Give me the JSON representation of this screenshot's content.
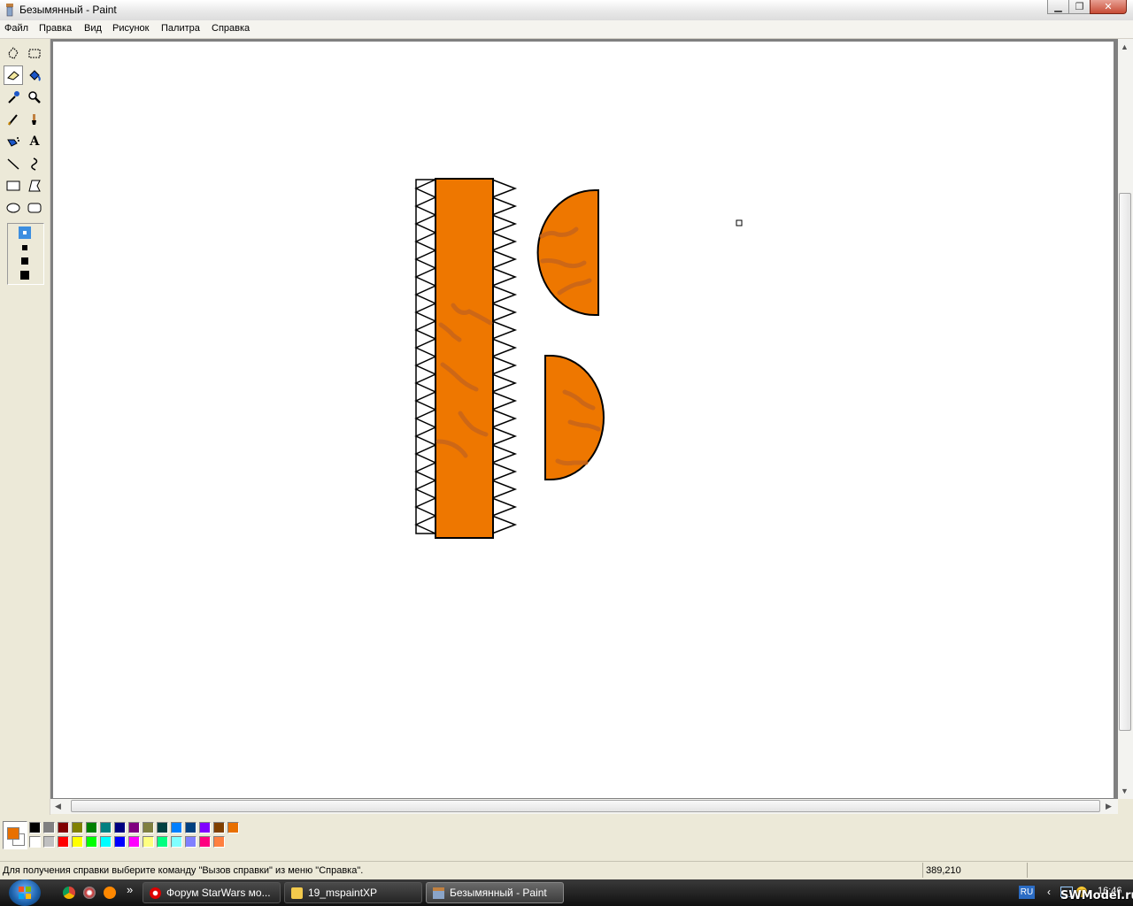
{
  "window": {
    "title": "Безымянный - Paint",
    "controls": {
      "minimize": "▁",
      "maximize": "❐",
      "close": "✕"
    }
  },
  "menu": [
    "Файл",
    "Правка",
    "Вид",
    "Рисунок",
    "Палитра",
    "Справка"
  ],
  "tools": [
    {
      "name": "free-select-icon"
    },
    {
      "name": "rect-select-icon"
    },
    {
      "name": "eraser-icon",
      "active": true
    },
    {
      "name": "fill-icon"
    },
    {
      "name": "color-picker-icon"
    },
    {
      "name": "magnifier-icon"
    },
    {
      "name": "pencil-icon"
    },
    {
      "name": "brush-icon"
    },
    {
      "name": "airbrush-icon"
    },
    {
      "name": "text-icon",
      "glyph": "A"
    },
    {
      "name": "line-icon"
    },
    {
      "name": "curve-icon"
    },
    {
      "name": "rectangle-icon"
    },
    {
      "name": "polygon-icon"
    },
    {
      "name": "ellipse-icon"
    },
    {
      "name": "rounded-rect-icon"
    }
  ],
  "eraser_sizes": [
    "small",
    "medium",
    "large",
    "xlarge"
  ],
  "colors": {
    "foreground": "#e87000",
    "background": "#ffffff",
    "shape_fill": "#ee7700",
    "shape_stroke": "#000000",
    "texture": "#c8651a",
    "palette_row1": [
      "#000000",
      "#808080",
      "#800000",
      "#808000",
      "#008000",
      "#008080",
      "#000080",
      "#800080",
      "#808040",
      "#004040",
      "#0080ff",
      "#004080",
      "#8000ff",
      "#804000",
      "#e87000"
    ],
    "palette_row2": [
      "#ffffff",
      "#c0c0c0",
      "#ff0000",
      "#ffff00",
      "#00ff00",
      "#00ffff",
      "#0000ff",
      "#ff00ff",
      "#ffff80",
      "#00ff80",
      "#80ffff",
      "#8080ff",
      "#ff0080",
      "#ff8040"
    ]
  },
  "status": {
    "help": "Для получения справки выберите команду \"Вызов справки\" из меню \"Справка\".",
    "coords": "389,210"
  },
  "taskbar": {
    "tasks": [
      {
        "label": "Форум StarWars мо...",
        "icon": "opera-icon"
      },
      {
        "label": "19_mspaintXP",
        "icon": "folder-icon"
      },
      {
        "label": "Безымянный - Paint",
        "icon": "paint-icon",
        "active": true
      }
    ],
    "language": "RU",
    "clock": "16:46",
    "watermark": "SWModel.ru",
    "quicklaunch_more": "»"
  }
}
